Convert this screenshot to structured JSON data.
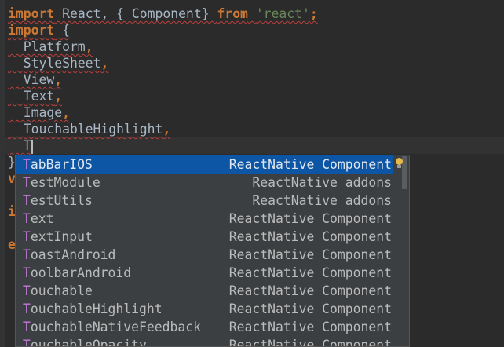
{
  "editor": {
    "lines": [
      {
        "parts": [
          {
            "t": "import",
            "c": "kw"
          },
          {
            "t": " React, { Component} ",
            "c": "gray"
          },
          {
            "t": "from",
            "c": "kw"
          },
          {
            "t": " ",
            "c": "gray"
          },
          {
            "t": "'react'",
            "c": "str"
          },
          {
            "t": ";",
            "c": "kw"
          }
        ]
      },
      {
        "parts": [
          {
            "t": "import",
            "c": "kw"
          },
          {
            "t": " {",
            "c": "gray"
          }
        ]
      },
      {
        "parts": [
          {
            "t": "  Platform",
            "c": "gray"
          },
          {
            "t": ",",
            "c": "kw"
          }
        ]
      },
      {
        "parts": [
          {
            "t": "  StyleSheet",
            "c": "gray"
          },
          {
            "t": ",",
            "c": "kw"
          }
        ]
      },
      {
        "parts": [
          {
            "t": "  View",
            "c": "gray"
          },
          {
            "t": ",",
            "c": "kw"
          }
        ]
      },
      {
        "parts": [
          {
            "t": "  Text",
            "c": "gray"
          },
          {
            "t": ",",
            "c": "kw"
          }
        ]
      },
      {
        "parts": [
          {
            "t": "  Image",
            "c": "gray"
          },
          {
            "t": ",",
            "c": "kw"
          }
        ]
      },
      {
        "parts": [
          {
            "t": "  TouchableHighlight",
            "c": "gray"
          },
          {
            "t": ",",
            "c": "kw"
          }
        ]
      },
      {
        "parts": [
          {
            "t": "  T",
            "c": "gray"
          }
        ],
        "caret": true
      },
      {
        "parts": [
          {
            "t": "}",
            "c": "gray"
          }
        ]
      },
      {
        "parts": [
          {
            "t": "v",
            "c": "kw"
          }
        ]
      },
      {
        "parts": []
      },
      {
        "parts": [
          {
            "t": "i",
            "c": "kw"
          }
        ]
      },
      {
        "parts": []
      },
      {
        "parts": [
          {
            "t": "e",
            "c": "kw"
          }
        ]
      }
    ]
  },
  "completion": {
    "typed_prefix": "T",
    "items": [
      {
        "name": "TabBarIOS",
        "type": "ReactNative Component",
        "selected": true
      },
      {
        "name": "TestModule",
        "type": "ReactNative addons"
      },
      {
        "name": "TestUtils",
        "type": "ReactNative addons"
      },
      {
        "name": "Text",
        "type": "ReactNative Component"
      },
      {
        "name": "TextInput",
        "type": "ReactNative Component"
      },
      {
        "name": "ToastAndroid",
        "type": "ReactNative Component"
      },
      {
        "name": "ToolbarAndroid",
        "type": "ReactNative Component"
      },
      {
        "name": "Touchable",
        "type": "ReactNative Component"
      },
      {
        "name": "TouchableHighlight",
        "type": "ReactNative Component"
      },
      {
        "name": "TouchableNativeFeedback",
        "type": "ReactNative Component"
      },
      {
        "name": "TouchableOpacity",
        "type": "ReactNative Component"
      }
    ]
  },
  "colors": {
    "background": "#2b2b2b",
    "popup": "#3c3f41",
    "selection": "#0d56a6",
    "keyword": "#cc7832",
    "string": "#6a8759",
    "match": "#c27bd8"
  }
}
